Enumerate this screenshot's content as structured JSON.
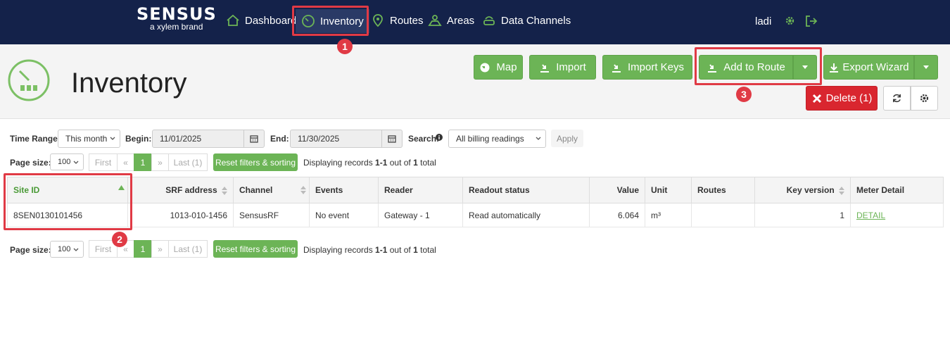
{
  "brand": {
    "name": "SENSUS",
    "sub": "a xylem brand"
  },
  "nav": {
    "dashboard": "Dashboard",
    "inventory": "Inventory",
    "routes": "Routes",
    "areas": "Areas",
    "data_channels": "Data Channels"
  },
  "user": {
    "name": "ladi"
  },
  "page": {
    "title": "Inventory"
  },
  "toolbar": {
    "map": "Map",
    "import": "Import",
    "import_keys": "Import Keys",
    "add_to_route": "Add to Route",
    "export_wizard": "Export Wizard",
    "delete": "Delete (1)"
  },
  "filters": {
    "time_range_label": "Time Range:",
    "time_range_value": "This month",
    "begin_label": "Begin:",
    "begin_value": "11/01/2025",
    "end_label": "End:",
    "end_value": "11/30/2025",
    "search_label": "Search:",
    "search_value": "All billing readings",
    "apply": "Apply"
  },
  "pager": {
    "page_size_label": "Page size:",
    "page_size": "100",
    "first": "First",
    "prev": "«",
    "current": "1",
    "next": "»",
    "last": "Last (1)",
    "reset": "Reset filters & sorting",
    "display_prefix": "Displaying records ",
    "range": "1-1",
    "out_of": " out of ",
    "total": "1",
    "total_suffix": " total"
  },
  "table": {
    "headers": [
      "Site ID",
      "SRF address",
      "Channel",
      "Events",
      "Reader",
      "Readout status",
      "Value",
      "Unit",
      "Routes",
      "Key version",
      "Meter Detail"
    ],
    "rows": [
      [
        "8SEN0130101456",
        "1013-010-1456",
        "SensusRF",
        "No event",
        "Gateway - 1",
        "Read automatically",
        "6.064",
        "m³",
        "",
        "1",
        "DETAIL"
      ]
    ]
  },
  "annotations": [
    "1",
    "2",
    "3"
  ],
  "colors": {
    "nav_bg": "#14224a",
    "accent": "#6cb456",
    "danger": "#d9262f",
    "highlight": "#e03a45"
  }
}
